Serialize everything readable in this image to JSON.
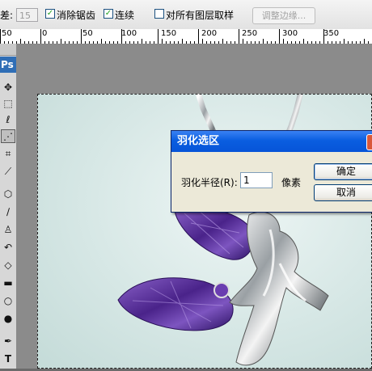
{
  "options_bar": {
    "tolerance_label": "差:",
    "tolerance_value": "15",
    "anti_alias_label": "消除锯齿",
    "anti_alias_checked": true,
    "contiguous_label": "连续",
    "contiguous_checked": true,
    "sample_all_layers_label": "对所有图层取样",
    "sample_all_layers_checked": false,
    "refine_edge_label": "调整边缘..."
  },
  "ruler": {
    "labels": [
      "50",
      "0",
      "50",
      "100",
      "150",
      "200",
      "250",
      "300",
      "350"
    ]
  },
  "toolbar": {
    "logo": "Ps",
    "tools": [
      "move-icon",
      "marquee-icon",
      "lasso-icon",
      "magic-wand-icon",
      "crop-icon",
      "eyedropper-icon",
      "healing-brush-icon",
      "brush-icon",
      "clone-stamp-icon",
      "history-brush-icon",
      "eraser-icon",
      "gradient-icon",
      "blur-icon",
      "dodge-icon",
      "pen-icon",
      "type-icon"
    ]
  },
  "dialog": {
    "title": "羽化选区",
    "radius_label": "羽化半径(R):",
    "radius_value": "1",
    "unit": "像素",
    "ok": "确定",
    "cancel": "取消"
  },
  "colors": {
    "dialog_title": "#0a5ee0",
    "toolbar_logo": "#2f6eb6",
    "amethyst": "#5b2f9e"
  }
}
